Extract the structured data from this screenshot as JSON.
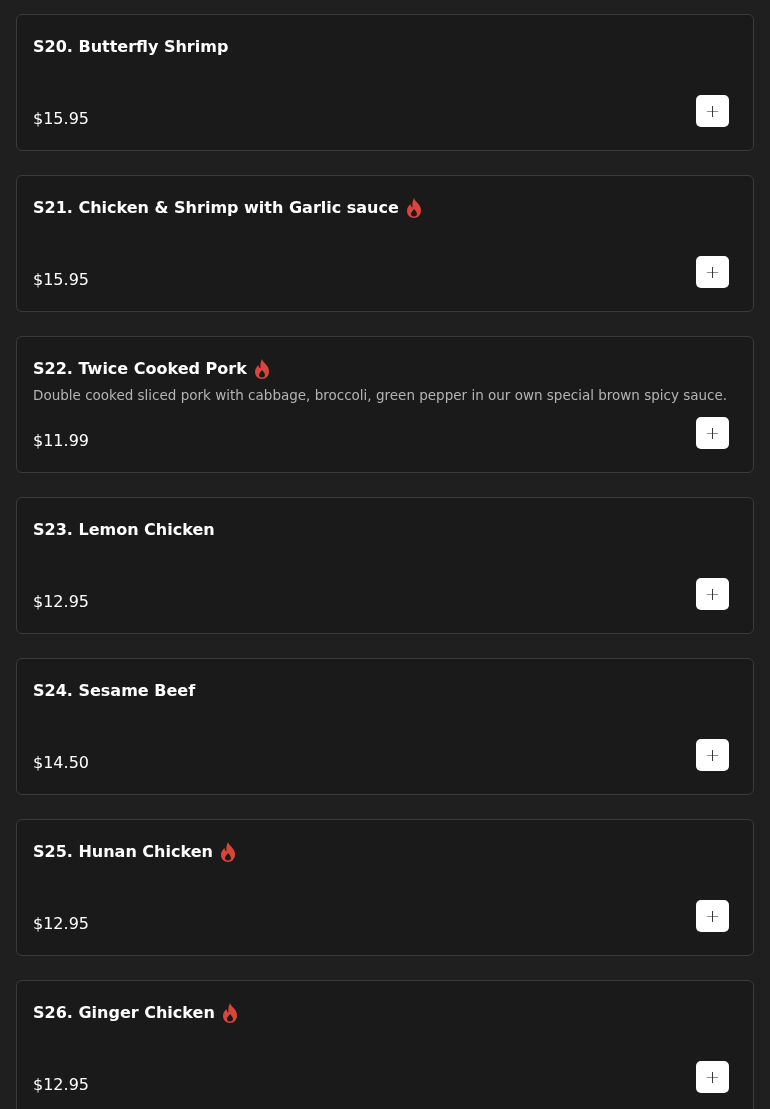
{
  "items": [
    {
      "name": "S20. Butterfly Shrimp",
      "spicy": false,
      "price": "$15.95",
      "add": "+"
    },
    {
      "name": "S21. Chicken & Shrimp with Garlic sauce",
      "spicy": true,
      "price": "$15.95",
      "add": "+"
    },
    {
      "name": "S22. Twice Cooked Pork",
      "spicy": true,
      "description": "Double cooked sliced pork with cabbage, broccoli, green pepper in our own special brown spicy sauce.",
      "price": "$11.99",
      "add": "+"
    },
    {
      "name": "S23. Lemon Chicken",
      "spicy": false,
      "price": "$12.95",
      "add": "+"
    },
    {
      "name": "S24. Sesame Beef",
      "spicy": false,
      "price": "$14.50",
      "add": "+"
    },
    {
      "name": "S25. Hunan Chicken",
      "spicy": true,
      "price": "$12.95",
      "add": "+"
    },
    {
      "name": "S26. Ginger Chicken",
      "spicy": true,
      "price": "$12.95",
      "add": "+"
    }
  ]
}
